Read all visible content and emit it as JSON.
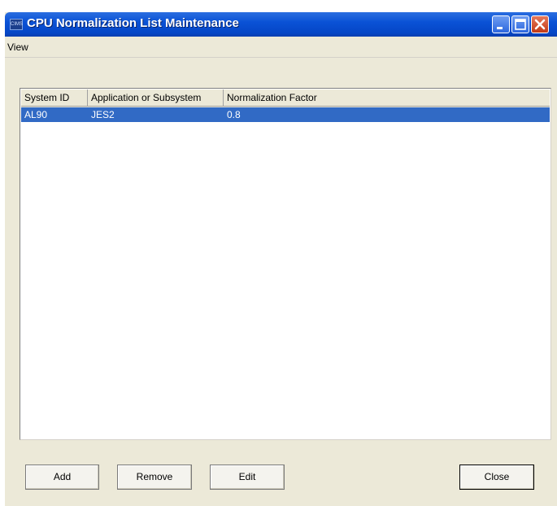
{
  "window": {
    "title": "CPU Normalization List Maintenance",
    "app_icon_text": "CIMS",
    "controls": [
      "minimize-icon",
      "maximize-icon",
      "close-icon"
    ]
  },
  "menu": {
    "items": [
      {
        "label": "View"
      }
    ]
  },
  "table": {
    "columns": [
      "System ID",
      "Application or Subsystem",
      "Normalization Factor"
    ],
    "rows": [
      {
        "system_id": "AL90",
        "application": "JES2",
        "factor": "0.8",
        "selected": true
      }
    ]
  },
  "buttons": {
    "add": "Add",
    "remove": "Remove",
    "edit": "Edit",
    "close": "Close"
  },
  "colors": {
    "titlebar": "#0a52d6",
    "selection": "#316ac5",
    "window_bg": "#ece9d8",
    "close_button": "#c23a17"
  }
}
